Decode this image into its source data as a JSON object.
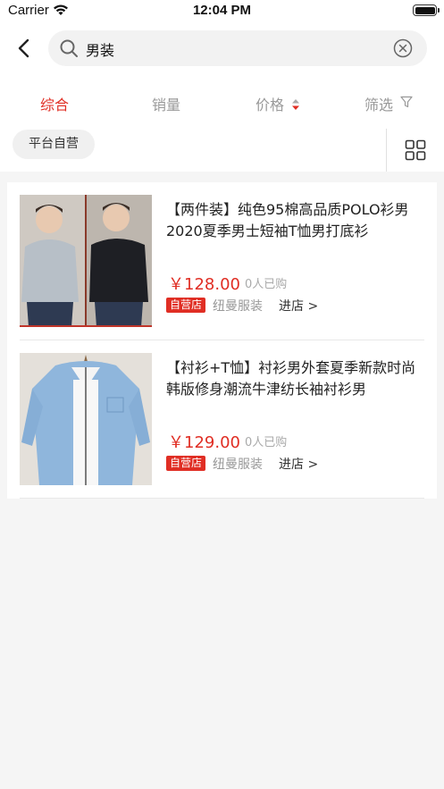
{
  "status_bar": {
    "carrier": "Carrier",
    "time": "12:04 PM"
  },
  "search": {
    "query": "男装"
  },
  "tabs": [
    {
      "label": "综合",
      "active": true
    },
    {
      "label": "销量",
      "active": false
    },
    {
      "label": "价格",
      "active": false
    },
    {
      "label": "筛选",
      "active": false
    }
  ],
  "chips": {
    "platform": "平台自营"
  },
  "products": [
    {
      "title": "【两件装】纯色95棉高品质POLO衫男 2020夏季男士短袖T恤男打底衫",
      "price": "￥128.00",
      "sold": "0人已购",
      "badge": "自营店",
      "shop": "纽曼服装",
      "enter_label": "进店 >"
    },
    {
      "title": "【衬衫+T恤】衬衫男外套夏季新款时尚韩版修身潮流牛津纺长袖衬衫男",
      "price": "￥129.00",
      "sold": "0人已购",
      "badge": "自营店",
      "shop": "纽曼服装",
      "enter_label": "进店 >"
    }
  ],
  "colors": {
    "accent": "#e02e24",
    "muted": "#999999",
    "background": "#f5f5f5"
  }
}
